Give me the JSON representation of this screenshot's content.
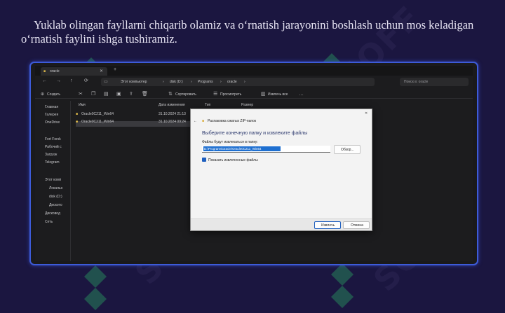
{
  "slide": {
    "heading": "Yuklab olingan fayllarni chiqarib olamiz va o‘rnatish jarayonini boshlash uchun mos keladigan o‘rnatish faylini ishga tushiramiz."
  },
  "watermark": {
    "text": "SOFF",
    "color": "#7a6eaa",
    "accent": "#2fbf6a"
  },
  "explorer": {
    "tab_title": "oracle",
    "breadcrumb": [
      "Этот компьютер",
      "disk (D:)",
      "Programs",
      "oracle"
    ],
    "search_placeholder": "Поиск в: oracle",
    "toolbar": {
      "new": "Создать",
      "sort": "Сортировать",
      "view": "Просмотреть",
      "extract_all": "Извлечь все"
    },
    "columns": [
      "Имя",
      "Дата изменения",
      "Тип",
      "Размер"
    ],
    "files": [
      {
        "name": "Oracle0C211_Win64",
        "date": "31.10.2024 21:13"
      },
      {
        "name": "Oracle0C211_Win64",
        "date": "31.10.2024 09:24"
      }
    ],
    "sidebar": [
      "Главная",
      "Галерея",
      "OneDrive",
      "Fort Forsk",
      "Рабочий с",
      "Загрузк",
      "Telegram",
      "Этот комп",
      "Локальн",
      "disk (D:)",
      "Диското",
      "Дисковод",
      "Сеть"
    ],
    "accent": "#1e6fd0"
  },
  "dialog": {
    "window_title": "Распаковка сжатых ZIP-папок",
    "heading": "Выберите конечную папку и извлеките файлы",
    "field_label": "Файлы будут извлекаться в папку:",
    "path_value": "D:\\Programs\\oracle\\Oracle0C211_Win64",
    "browse": "Обзор...",
    "checkbox_label": "Показать извлеченные файлы",
    "checkbox_checked": true,
    "extract": "Извлечь",
    "cancel": "Отмена",
    "close_glyph": "✕",
    "back_glyph": "←"
  }
}
